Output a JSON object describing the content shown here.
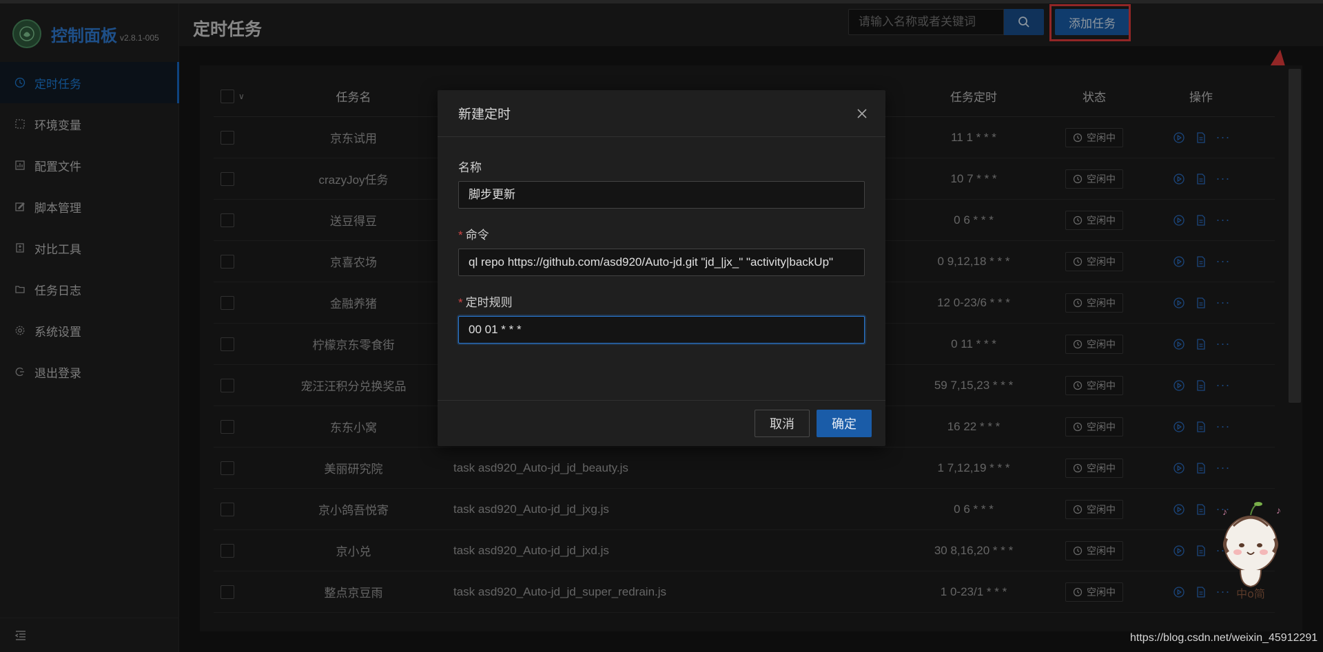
{
  "app": {
    "title": "控制面板",
    "version": "v2.8.1-005"
  },
  "sidebar": {
    "items": [
      {
        "label": "定时任务",
        "icon": "clock-icon",
        "active": true
      },
      {
        "label": "环境变量",
        "icon": "dashed-square-icon"
      },
      {
        "label": "配置文件",
        "icon": "chart-file-icon"
      },
      {
        "label": "脚本管理",
        "icon": "edit-icon"
      },
      {
        "label": "对比工具",
        "icon": "diff-icon"
      },
      {
        "label": "任务日志",
        "icon": "folder-icon"
      },
      {
        "label": "系统设置",
        "icon": "gear-icon"
      },
      {
        "label": "退出登录",
        "icon": "logout-icon"
      }
    ]
  },
  "header": {
    "page_title": "定时任务",
    "search_placeholder": "请输入名称或者关键词",
    "add_button": "添加任务"
  },
  "table": {
    "headers": {
      "name": "任务名",
      "cron": "任务定时",
      "status": "状态",
      "ops": "操作"
    },
    "rows": [
      {
        "name": "京东试用",
        "command": "",
        "cron": "11 1 * * *",
        "status": "空闲中"
      },
      {
        "name": "crazyJoy任务",
        "command": "",
        "cron": "10 7 * * *",
        "status": "空闲中"
      },
      {
        "name": "送豆得豆",
        "command": "",
        "cron": "0 6 * * *",
        "status": "空闲中"
      },
      {
        "name": "京喜农场",
        "command": "",
        "cron": "0 9,12,18 * * *",
        "status": "空闲中"
      },
      {
        "name": "金融养猪",
        "command": "",
        "cron": "12 0-23/6 * * *",
        "status": "空闲中"
      },
      {
        "name": "柠檬京东零食街",
        "command": "",
        "cron": "0 11 * * *",
        "status": "空闲中"
      },
      {
        "name": "宠汪汪积分兑换奖品",
        "command": "",
        "cron": "59 7,15,23 * * *",
        "status": "空闲中"
      },
      {
        "name": "东东小窝",
        "command": "",
        "cron": "16 22 * * *",
        "status": "空闲中"
      },
      {
        "name": "美丽研究院",
        "command": "task asd920_Auto-jd_jd_beauty.js",
        "cron": "1 7,12,19 * * *",
        "status": "空闲中"
      },
      {
        "name": "京小鸽吾悦寄",
        "command": "task asd920_Auto-jd_jd_jxg.js",
        "cron": "0 6 * * *",
        "status": "空闲中"
      },
      {
        "name": "京小兑",
        "command": "task asd920_Auto-jd_jd_jxd.js",
        "cron": "30 8,16,20 * * *",
        "status": "空闲中"
      },
      {
        "name": "整点京豆雨",
        "command": "task asd920_Auto-jd_jd_super_redrain.js",
        "cron": "1 0-23/1 * * *",
        "status": "空闲中"
      }
    ]
  },
  "modal": {
    "title": "新建定时",
    "name_label": "名称",
    "name_value": "脚步更新",
    "command_label": "命令",
    "command_value": "ql repo https://github.com/asd920/Auto-jd.git \"jd_|jx_\" \"activity|backUp\"",
    "cron_label": "定时规则",
    "cron_value": "00 01 * * *",
    "required_mark": "*",
    "cancel": "取消",
    "ok": "确定"
  },
  "mascot_text": "中o简",
  "watermark": "https://blog.csdn.net/weixin_45912291",
  "colors": {
    "accent": "#1a5ca8",
    "highlight": "#e03b3b",
    "link": "#2a6cc0"
  }
}
